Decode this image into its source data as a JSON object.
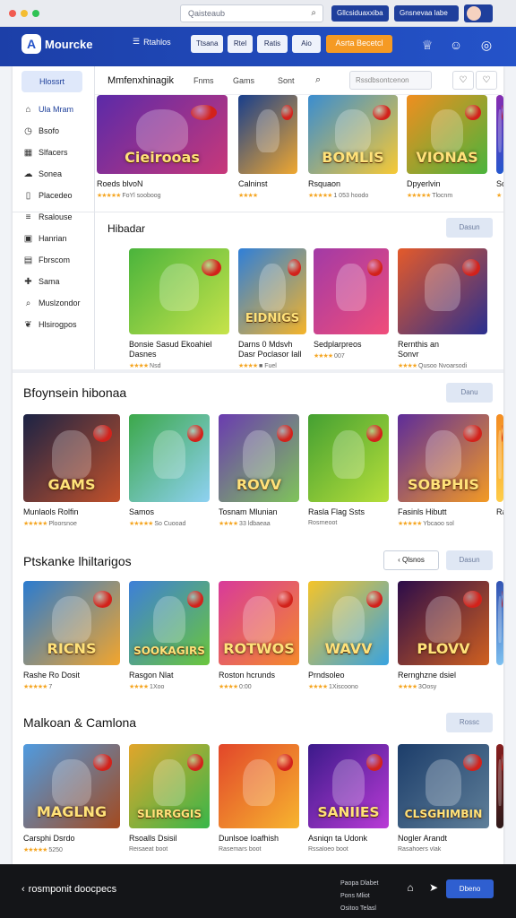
{
  "browser": {
    "address": "Qaisteaub",
    "extension_label": "Gllcsiduaxxiba",
    "profile_label": "Gnsnevaa labe"
  },
  "topnav": {
    "logo": "Mourcke",
    "link_label": "Rtahlos",
    "pills": [
      "Ttsana",
      "Rtel",
      "Ratis",
      "Aio"
    ],
    "cta_label": "Asrta Becetcl"
  },
  "sidebar": {
    "home_label": "Hlossrt",
    "items": [
      {
        "label": "Ula Mram",
        "icon": "home-icon"
      },
      {
        "label": "Bsofo",
        "icon": "clock-icon"
      },
      {
        "label": "Slfacers",
        "icon": "grid-icon"
      },
      {
        "label": "Sonea",
        "icon": "cloud-icon"
      },
      {
        "label": "Placedeo",
        "icon": "file-icon"
      },
      {
        "label": "Rsalouse",
        "icon": "stack-icon"
      },
      {
        "label": "Hanrian",
        "icon": "tile-icon"
      },
      {
        "label": "Fbrscom",
        "icon": "chart-icon"
      },
      {
        "label": "Sama",
        "icon": "gamepad-icon"
      },
      {
        "label": "Muslzondor",
        "icon": "search-icon"
      },
      {
        "label": "Hlsirogpos",
        "icon": "leaf-icon"
      }
    ]
  },
  "toolbar": {
    "title": "Mmfenxhinagik",
    "tabs": [
      "Fnms",
      "Gams",
      "Sont"
    ],
    "search_placeholder": "Rssdbsontcenon",
    "heart_label": "♡"
  },
  "rows": {
    "top": [
      {
        "title": "Roeds blvoN",
        "meta": "★★★★★ FoYl sooboog",
        "colors": [
          "#5b2aa8",
          "#c8387a"
        ],
        "glyph": "Cieirooas"
      },
      {
        "title": "Calninst",
        "meta": "★★★★",
        "colors": [
          "#183e8c",
          "#f0a830"
        ],
        "glyph": ""
      },
      {
        "title": "Rsquaon",
        "meta": "★★★★★ 1 053 hoodo",
        "colors": [
          "#3a8dd0",
          "#f7c935"
        ],
        "glyph": "BOMLIS"
      },
      {
        "title": "Dpyerlvin",
        "meta": "★★★★★ Tlocnm",
        "colors": [
          "#f08e1f",
          "#4ab43c"
        ],
        "glyph": "VIONAS"
      },
      {
        "title": "So",
        "meta": "★",
        "colors": [
          "#8a2ab0",
          "#1f5ad0"
        ],
        "glyph": ""
      }
    ],
    "hibadar": {
      "title": "Hibadar",
      "see_all": "Dasun",
      "items": [
        {
          "title": "Bonsie Sasud Ekoahiel",
          "sub": "Dasnes",
          "meta": "★★★★ Nsd",
          "colors": [
            "#4ab43c",
            "#c7e34a"
          ],
          "glyph": ""
        },
        {
          "title": "Darns 0 Mdsvh",
          "sub": "Dasr Poclasor Iall",
          "meta": "★★★★ ■ Fuel",
          "colors": [
            "#2f7fd8",
            "#f5b42a"
          ],
          "glyph": "EIDNIGS"
        },
        {
          "title": "Sedplarpreos",
          "sub": "",
          "meta": "★★★★ 007",
          "colors": [
            "#a23aa6",
            "#f04d7a"
          ],
          "glyph": ""
        },
        {
          "title": "Rernthis an",
          "sub": "Sonvr",
          "meta": "★★★★ Qusoo Nvoarsodi",
          "colors": [
            "#e45a2a",
            "#2a2f8f"
          ],
          "glyph": ""
        }
      ]
    },
    "popular": {
      "title": "Bfoynsein hibonaa",
      "see_all": "Danu",
      "items": [
        {
          "title": "Munlaols Rolfin",
          "meta": "★★★★★ Ploorsnoe",
          "colors": [
            "#1b2345",
            "#c2512a"
          ],
          "glyph": "GAMS"
        },
        {
          "title": "Samos",
          "meta": "★★★★★ So Cuooad",
          "colors": [
            "#3ca84a",
            "#8ed1f2"
          ],
          "glyph": ""
        },
        {
          "title": "Tosnam Mlunian",
          "meta": "★★★★ 33 ldbaeaa",
          "colors": [
            "#6a3bb0",
            "#7fc45a"
          ],
          "glyph": "ROVV"
        },
        {
          "title": "Rasla Flag Ssts",
          "meta": "Rosrneoot",
          "colors": [
            "#44a032",
            "#b7df3a"
          ],
          "glyph": ""
        },
        {
          "title": "Fasinls Hibutt",
          "meta": "★★★★★ Ybcaoo sol",
          "colors": [
            "#5d2c9a",
            "#f39a24"
          ],
          "glyph": "SOBPHIS"
        },
        {
          "title": "Ra",
          "meta": "",
          "colors": [
            "#f38a21",
            "#ffd04a"
          ],
          "glyph": ""
        }
      ]
    },
    "pranks": {
      "title": "Ptskanke lhiltarigos",
      "filter_label": "Qlsnos",
      "see_all": "Dasun",
      "items": [
        {
          "title": "Rashe Ro Dosit",
          "meta": "★★★★★ 7",
          "colors": [
            "#2a7bd0",
            "#f3a52c"
          ],
          "glyph": "RICNS"
        },
        {
          "title": "Rasgon Nlat",
          "meta": "★★★★ 1Xoo",
          "colors": [
            "#3d7fd8",
            "#6ac63c"
          ],
          "glyph": "SOOKAGIRS"
        },
        {
          "title": "Roston hcrunds",
          "meta": "★★★★ 0:00",
          "colors": [
            "#d83a9a",
            "#f58a2a"
          ],
          "glyph": "ROTWOS"
        },
        {
          "title": "Prndsoleo",
          "meta": "★★★★ 1Xiscoono",
          "colors": [
            "#f4c42a",
            "#38a3e0"
          ],
          "glyph": "WAVV"
        },
        {
          "title": "Rernghzne dsiel",
          "meta": "★★★★ 3Oosy",
          "colors": [
            "#2b0c4a",
            "#d0601f"
          ],
          "glyph": "PLOVV"
        },
        {
          "title": "",
          "meta": "",
          "colors": [
            "#2f4fb0",
            "#7fc4f2"
          ],
          "glyph": ""
        }
      ]
    },
    "makeover": {
      "title": "Malkoan & Camlona",
      "see_all": "Rossc",
      "items": [
        {
          "title": "Carsphi Dsrdo",
          "meta": "★★★★★ 5250",
          "colors": [
            "#4f9be0",
            "#a34a1f"
          ],
          "glyph": "MAGLNG"
        },
        {
          "title": "Rsoalls Dsisil",
          "meta": "Reisaeat boot",
          "colors": [
            "#e2a52a",
            "#38b74a"
          ],
          "glyph": "SLIRRGGIS"
        },
        {
          "title": "Dunlsoe Ioafhish",
          "meta": "Rasemars boot",
          "colors": [
            "#e2462a",
            "#f7b52f"
          ],
          "glyph": ""
        },
        {
          "title": "Asniqn ta Udonk",
          "meta": "Rssaloeo boot",
          "colors": [
            "#3b1a8a",
            "#b93bd6"
          ],
          "glyph": "SANIIES"
        },
        {
          "title": "Nogler Arandt",
          "meta": "Rasahoers vlak",
          "colors": [
            "#1c3d6a",
            "#5f7f99"
          ],
          "glyph": "CLSGHIMBIN"
        },
        {
          "title": "",
          "meta": "",
          "colors": [
            "#8a1f1f",
            "#2a1a1a"
          ],
          "glyph": ""
        }
      ]
    }
  },
  "footer": {
    "back_label": "rosmponit doocpecs",
    "links": [
      "Paopa Dlabet",
      "Pons Mliot",
      "Ositoo Telasl"
    ],
    "cta_label": "Dbeno"
  }
}
